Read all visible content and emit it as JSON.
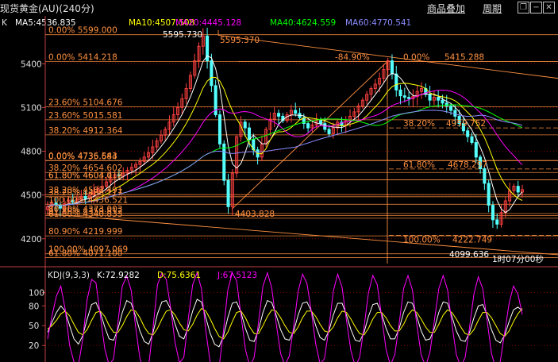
{
  "header": {
    "title": "现货黄金(AU)(240分)",
    "btn_overlay": "商品叠加",
    "btn_period": "周期",
    "win_icons": [
      "restore-icon",
      "minimize-icon",
      "close-icon"
    ]
  },
  "legend": {
    "k": "K",
    "ma": [
      {
        "label": "MA5:4536.835",
        "color": "#ffffff"
      },
      {
        "label": "MA10:4507.508",
        "color": "#ffff00"
      },
      {
        "label": "MA20:4445.128",
        "color": "#ff00ff"
      },
      {
        "label": "MA40:4624.559",
        "color": "#00ff00"
      },
      {
        "label": "MA60:4770.541",
        "color": "#8a8aff"
      }
    ]
  },
  "kdj_legend": {
    "name": "KDJ(9,3,3)",
    "k": "K:72.9282",
    "d": "D:75.6361",
    "j": "J:67.5123"
  },
  "colors": {
    "bg": "#000000",
    "up": "#ff4040",
    "down": "#54ffff",
    "fib": "#ff9040",
    "grid": "#800000",
    "axis": "#c04040",
    "axis_text": "#e0e0e0"
  },
  "chart_data": [
    {
      "type": "candlestick",
      "y_ticks": [
        "5400",
        "5100",
        "4800",
        "4500",
        "4200"
      ],
      "ylim": [
        4030,
        5630
      ],
      "highs": [
        {
          "label": "5595.730",
          "value": 5595.73
        },
        {
          "label": "5595.370",
          "value": 5595.37
        }
      ],
      "lows": [
        {
          "label": "4099.636",
          "value": 4099.636
        },
        {
          "label": "4403.828",
          "value": 4403.828
        }
      ],
      "timer": "1时07分00秒",
      "fib_left": [
        {
          "label": "0.00% 5599.000",
          "value": 5599.0
        },
        {
          "label": "0.00% 5414.218",
          "value": 5414.218
        },
        {
          "label": "23.60% 5104.676",
          "value": 5104.676
        },
        {
          "label": "23.60% 5015.581",
          "value": 5015.581
        },
        {
          "label": "38.20% 4912.364",
          "value": 4912.364
        },
        {
          "label": "0.00% 4736.543",
          "value": 4736.543
        },
        {
          "label": "0.00% 4735.684",
          "value": 4735.684
        },
        {
          "label": "38.20% 4654.602",
          "value": 4654.602
        },
        {
          "label": "61.80% 4604.012",
          "value": 4604.012
        },
        {
          "label": "61.80% 4603.418",
          "value": 4603.418
        },
        {
          "label": "38.20% 4502.491",
          "value": 4502.491
        },
        {
          "label": "38.20% 4488.117",
          "value": 4488.117
        },
        {
          "label": "100.00% 4436.521",
          "value": 4436.521
        },
        {
          "label": "80.90% 4373.003",
          "value": 4373.003
        },
        {
          "label": "61.80% 4359.812",
          "value": 4359.812
        },
        {
          "label": "61.80% 4340.833",
          "value": 4340.833
        },
        {
          "label": "80.90% 4219.999",
          "value": 4219.999
        },
        {
          "label": "100.00% 4097.069",
          "value": 4097.069
        },
        {
          "label": "61.80% 4071.100",
          "value": 4071.1
        }
      ],
      "fib_right": [
        {
          "label": "-84.90%",
          "value": 5414.218
        },
        {
          "label": "0.00%",
          "value": 5414.218
        },
        {
          "label": "5415.288",
          "value": 5415.288
        },
        {
          "label": "38.20%",
          "value": 4959.752
        },
        {
          "label": "4959.752",
          "value": 4959.752
        },
        {
          "label": "61.80%",
          "value": 4678.297
        },
        {
          "label": "4678.297",
          "value": 4678.297
        },
        {
          "label": "100.00%",
          "value": 4222.749
        },
        {
          "label": "4222.749",
          "value": 4222.749
        }
      ],
      "close_series": [
        4420,
        4445,
        4430,
        4410,
        4440,
        4465,
        4450,
        4470,
        4490,
        4475,
        4500,
        4520,
        4545,
        4560,
        4590,
        4620,
        4640,
        4630,
        4650,
        4670,
        4690,
        4710,
        4730,
        4760,
        4790,
        4830,
        4870,
        4910,
        4950,
        5000,
        5050,
        5100,
        5160,
        5230,
        5320,
        5420,
        5520,
        5590,
        5420,
        5250,
        5050,
        4850,
        4600,
        4420,
        4650,
        4900,
        5000,
        4960,
        4880,
        4810,
        4760,
        4850,
        4950,
        5020,
        5060,
        5040,
        5010,
        5050,
        5080,
        5060,
        5030,
        4990,
        4960,
        4980,
        5010,
        4990,
        4950,
        4920,
        4960,
        5000,
        4980,
        5010,
        5040,
        5070,
        5110,
        5150,
        5190,
        5230,
        5260,
        5300,
        5360,
        5420,
        5330,
        5220,
        5180,
        5170,
        5160,
        5175,
        5210,
        5230,
        5190,
        5150,
        5170,
        5150,
        5130,
        5110,
        5080,
        5040,
        4990,
        4940,
        4900,
        4860,
        4760,
        4680,
        4580,
        4430,
        4330,
        4300,
        4380,
        4460,
        4530,
        4560,
        4520,
        4537
      ]
    },
    {
      "type": "line",
      "name": "KDJ(9,3,3)",
      "y_ticks": [
        "100",
        "80",
        "50",
        "20"
      ],
      "ylim": [
        -5,
        120
      ],
      "series": [
        {
          "name": "K",
          "color": "#ffffff",
          "values": [
            40,
            55,
            70,
            80,
            72,
            50,
            30,
            22,
            35,
            60,
            82,
            85,
            70,
            48,
            30,
            28,
            45,
            70,
            88,
            84,
            65,
            42,
            26,
            22,
            40,
            68,
            86,
            88,
            75,
            52,
            34,
            30,
            48,
            72,
            90,
            86,
            62,
            38,
            22,
            18,
            34,
            62,
            84,
            86,
            70,
            46,
            28,
            26,
            44,
            70,
            88,
            85,
            66,
            44,
            30,
            28,
            42,
            66,
            84,
            86,
            72,
            50,
            32,
            28,
            42,
            66,
            84,
            84,
            66,
            44,
            28,
            26,
            40,
            64,
            82,
            84,
            68,
            46,
            30,
            30,
            46,
            70,
            86,
            84,
            64,
            42,
            28,
            30,
            46,
            70,
            86,
            84,
            64,
            42,
            28,
            26,
            40,
            62,
            80,
            82,
            66,
            44,
            28,
            24,
            36,
            56,
            74,
            78,
            73
          ]
        },
        {
          "name": "D",
          "color": "#ffff00",
          "values": [
            45,
            50,
            58,
            68,
            72,
            65,
            52,
            40,
            36,
            44,
            58,
            70,
            72,
            64,
            50,
            40,
            40,
            50,
            64,
            74,
            72,
            62,
            48,
            38,
            36,
            46,
            60,
            72,
            74,
            66,
            54,
            44,
            42,
            52,
            66,
            76,
            72,
            60,
            46,
            34,
            30,
            40,
            56,
            70,
            72,
            62,
            48,
            38,
            38,
            50,
            64,
            74,
            72,
            62,
            50,
            40,
            38,
            48,
            62,
            72,
            72,
            64,
            52,
            42,
            40,
            48,
            62,
            72,
            70,
            60,
            48,
            38,
            36,
            46,
            60,
            70,
            70,
            62,
            50,
            42,
            42,
            52,
            66,
            74,
            70,
            60,
            48,
            40,
            40,
            52,
            66,
            74,
            70,
            60,
            48,
            38,
            36,
            44,
            58,
            70,
            70,
            62,
            50,
            38,
            34,
            42,
            56,
            68,
            76
          ]
        },
        {
          "name": "J",
          "color": "#ff00ff",
          "values": [
            30,
            65,
            95,
            110,
            75,
            20,
            -5,
            -10,
            30,
            90,
            120,
            115,
            65,
            15,
            -10,
            0,
            55,
            110,
            125,
            104,
            50,
            0,
            -20,
            -10,
            48,
            112,
            130,
            120,
            77,
            24,
            -6,
            2,
            60,
            112,
            130,
            106,
            42,
            -6,
            -26,
            -14,
            42,
            104,
            130,
            118,
            66,
            14,
            -12,
            2,
            56,
            110,
            130,
            107,
            54,
            8,
            -10,
            4,
            50,
            102,
            128,
            114,
            72,
            22,
            -8,
            0,
            46,
            102,
            128,
            108,
            58,
            12,
            -12,
            2,
            48,
            100,
            126,
            112,
            64,
            14,
            -10,
            6,
            54,
            106,
            126,
            104,
            52,
            6,
            -12,
            10,
            58,
            106,
            126,
            104,
            52,
            6,
            -12,
            2,
            48,
            98,
            124,
            106,
            58,
            8,
            -16,
            -4,
            40,
            84,
            110,
            98,
            67
          ]
        }
      ]
    }
  ]
}
